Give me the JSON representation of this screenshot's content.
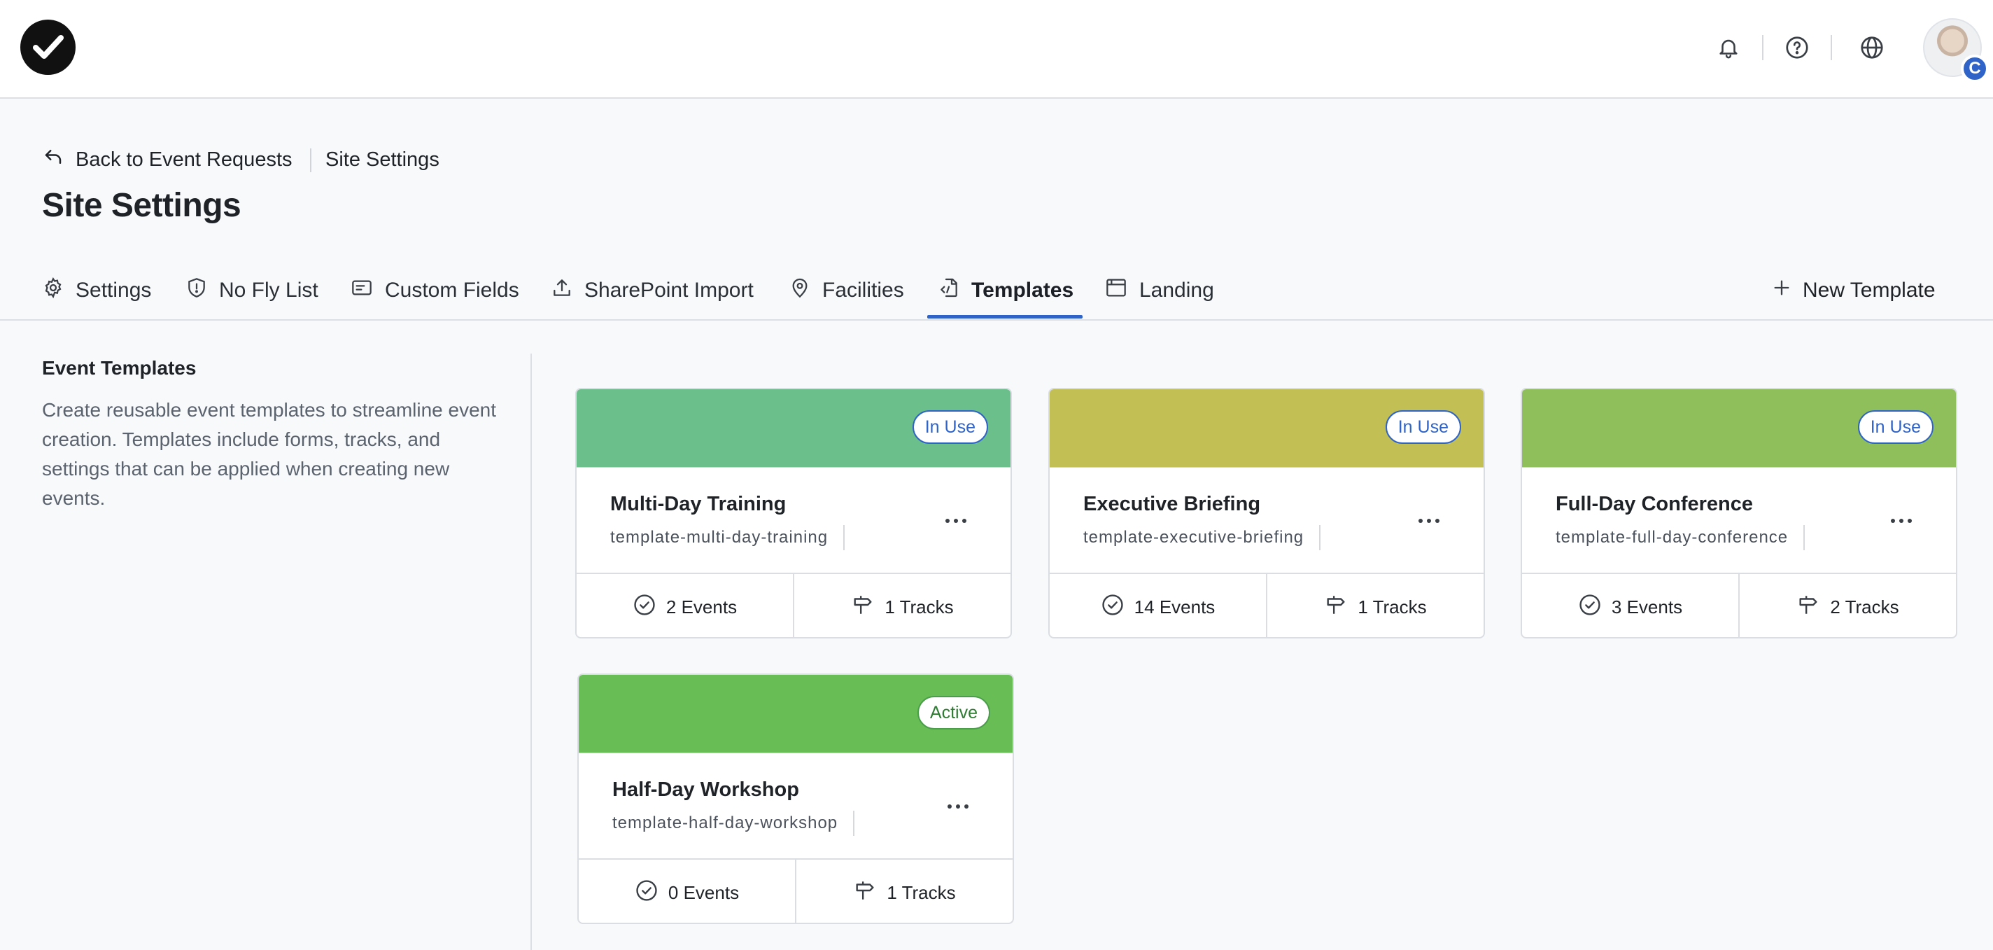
{
  "header": {
    "logo_icon": "checkmark-logo-icon",
    "icons": [
      "bell-icon",
      "help-circle-icon",
      "globe-icon"
    ],
    "avatar_badge": "C",
    "accent": "#2f63c7"
  },
  "breadcrumb": {
    "back_label": "Back to Event Requests",
    "current": "Site Settings"
  },
  "page_title": "Site Settings",
  "tabs": [
    {
      "label": "Settings",
      "icon": "gear-icon"
    },
    {
      "label": "No Fly List",
      "icon": "shield-alert-icon"
    },
    {
      "label": "Custom Fields",
      "icon": "form-field-icon"
    },
    {
      "label": "SharePoint Import",
      "icon": "upload-icon"
    },
    {
      "label": "Facilities",
      "icon": "map-pin-icon"
    },
    {
      "label": "Templates",
      "icon": "file-code-icon",
      "active": true
    },
    {
      "label": "Landing",
      "icon": "browser-window-icon"
    }
  ],
  "new_template_label": "New Template",
  "section": {
    "title": "Event Templates",
    "description": "Create reusable event templates to streamline event creation. Templates include forms, tracks, and settings that can be applied when creating new events."
  },
  "templates": [
    {
      "name": "Multi-Day Training",
      "slug": "template-multi-day-training",
      "badge": "In Use",
      "color": "#6bbf8a",
      "events": "2 Events",
      "tracks": "1 Tracks"
    },
    {
      "name": "Executive Briefing",
      "slug": "template-executive-briefing",
      "badge": "In Use",
      "color": "#c2c054",
      "events": "14 Events",
      "tracks": "1 Tracks"
    },
    {
      "name": "Full-Day Conference",
      "slug": "template-full-day-conference",
      "badge": "In Use",
      "color": "#8fbf5a",
      "events": "3 Events",
      "tracks": "2 Tracks"
    },
    {
      "name": "Half-Day Workshop",
      "slug": "template-half-day-workshop",
      "badge": "Active",
      "color": "#69bd55",
      "events": "0 Events",
      "tracks": "1 Tracks"
    }
  ]
}
